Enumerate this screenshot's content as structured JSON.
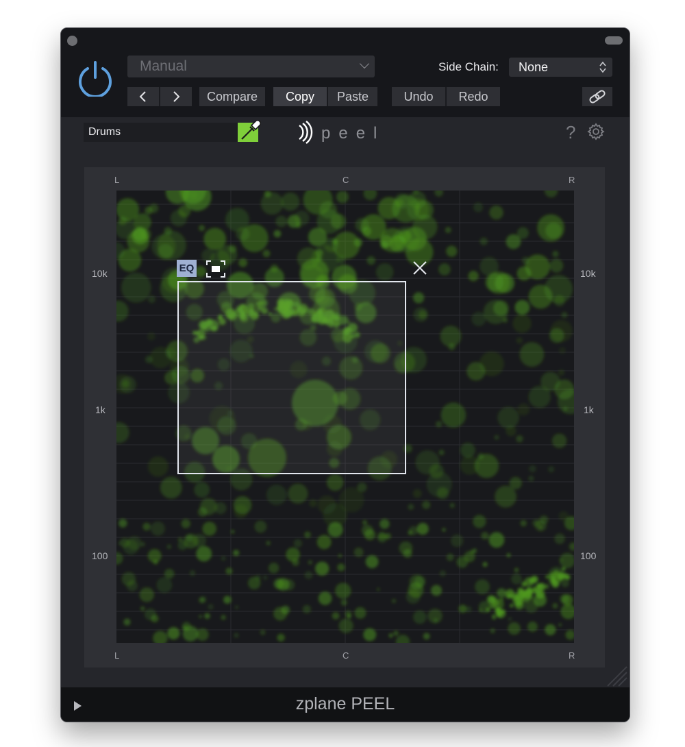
{
  "header": {
    "preset": "Manual",
    "side_chain_label": "Side Chain:",
    "side_chain_value": "None",
    "compare_label": "Compare",
    "copy_label": "Copy",
    "paste_label": "Paste",
    "undo_label": "Undo",
    "redo_label": "Redo"
  },
  "toolbar": {
    "track_name": "Drums",
    "help_label": "?",
    "logo_text": "peel",
    "picker_color": "#7fcf3a"
  },
  "plot": {
    "top_labels": [
      "L",
      "C",
      "R"
    ],
    "bottom_labels": [
      "L",
      "C",
      "R"
    ],
    "freq_labels": [
      "10k",
      "1k",
      "100"
    ],
    "eq_tag": "EQ",
    "blob_color": "#4f9a1e"
  },
  "footer": {
    "brand": "zplane PEEL"
  },
  "icons": [
    "power-icon",
    "chevron-down-icon",
    "chevron-left-icon",
    "chevron-right-icon",
    "link-icon",
    "eyedropper-icon",
    "gear-icon",
    "focus-icon",
    "close-icon",
    "play-icon"
  ]
}
